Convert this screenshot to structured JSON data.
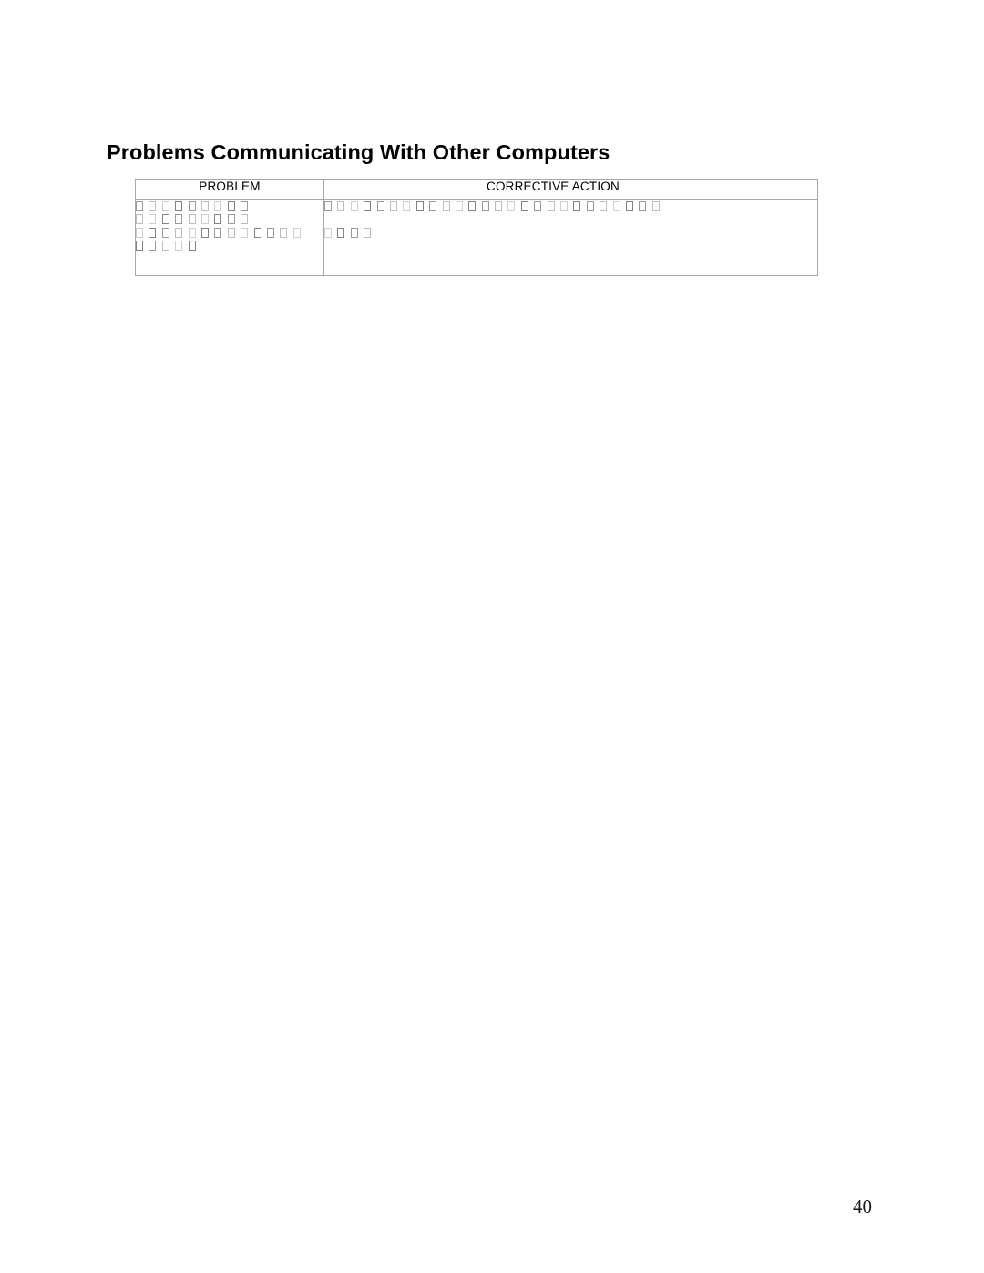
{
  "document": {
    "title": "Problems Communicating With Other Computers",
    "page_number": "40"
  },
  "table": {
    "headers": {
      "problem": "PROBLEM",
      "corrective_action": "CORRECTIVE ACTION"
    },
    "rows": [
      {
        "problem_glyph_runs": [
          9,
          9,
          13,
          5
        ],
        "corrective_action_glyph_runs": [
          26,
          0,
          4
        ]
      }
    ],
    "note": "Cell body text renders as missing-glyph (tofu) placeholder boxes; the underlying characters are not resolvable from the pixels."
  },
  "colors": {
    "text": "#000000",
    "border": "#a8a8a8",
    "tofu_border": "#b6b6b6",
    "background": "#ffffff"
  }
}
